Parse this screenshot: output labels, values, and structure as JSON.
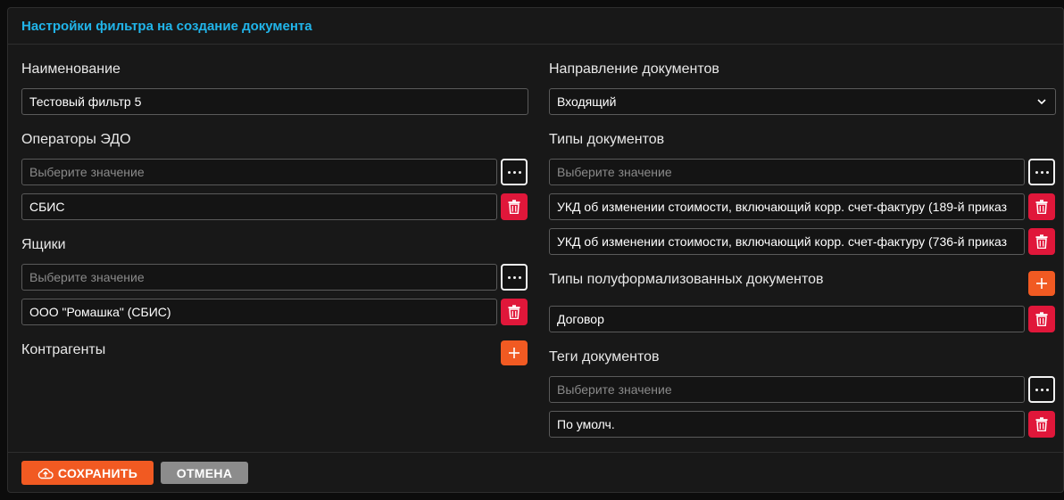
{
  "form": {
    "title": "Настройки фильтра на создание документа",
    "name": {
      "label": "Наименование",
      "value": "Тестовый фильтр 5"
    },
    "operators": {
      "label": "Операторы ЭДО",
      "placeholder": "Выберите значение",
      "items": [
        "СБИС"
      ]
    },
    "boxes": {
      "label": "Ящики",
      "placeholder": "Выберите значение",
      "items": [
        "ООО \"Ромашка\" (СБИС)"
      ]
    },
    "counterparties": {
      "label": "Контрагенты"
    },
    "direction": {
      "label": "Направление документов",
      "value": "Входящий"
    },
    "doc_types": {
      "label": "Типы документов",
      "placeholder": "Выберите значение",
      "items": [
        "УКД об изменении стоимости, включающий корр. счет-фактуру (189-й приказ",
        "УКД об изменении стоимости, включающий корр. счет-фактуру (736-й приказ"
      ]
    },
    "semi_formal": {
      "label": "Типы полуформализованных документов",
      "items": [
        "Договор"
      ]
    },
    "tags": {
      "label": "Теги документов",
      "placeholder": "Выберите значение",
      "items": [
        "По умолч."
      ]
    }
  },
  "footer": {
    "save_label": "СОХРАНИТЬ",
    "cancel_label": "ОТМЕНА"
  },
  "colors": {
    "accent_title": "#21b5ea",
    "primary_orange": "#f15a22",
    "delete_red": "#e0173a",
    "cancel_gray": "#8c8c8c"
  },
  "icons": {
    "more": "more-dots-icon",
    "delete": "trash-icon",
    "add": "plus-icon",
    "save": "cloud-upload-icon",
    "select": "chevron-down-icon"
  }
}
